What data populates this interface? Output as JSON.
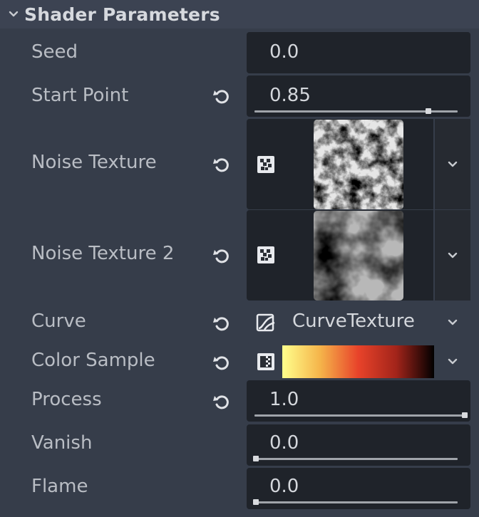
{
  "section": {
    "title": "Shader Parameters",
    "icon": "chevron-down-icon"
  },
  "params": {
    "seed": {
      "label": "Seed",
      "value": "0.0"
    },
    "start_point": {
      "label": "Start Point",
      "value": "0.85",
      "slider": 0.85
    },
    "noise_texture": {
      "label": "Noise Texture",
      "icon": "noise-texture-icon"
    },
    "noise_texture_2": {
      "label": "Noise Texture 2",
      "icon": "noise-texture-icon"
    },
    "curve": {
      "label": "Curve",
      "value": "CurveTexture",
      "icon": "curve-texture-icon"
    },
    "color_sample": {
      "label": "Color Sample",
      "icon": "gradient-texture-icon",
      "gradient": [
        "#ffff8c",
        "#f5b44a",
        "#e8432a",
        "#a3241a",
        "#000000"
      ]
    },
    "process": {
      "label": "Process",
      "value": "1.0",
      "slider": 1.0
    },
    "vanish": {
      "label": "Vanish",
      "value": "0.0",
      "slider": 0.0
    },
    "flame": {
      "label": "Flame",
      "value": "0.0",
      "slider": 0.0
    }
  },
  "colors": {
    "panel_bg": "#363d4a",
    "field_bg": "#1f232a",
    "label": "#b9bdc4",
    "value": "#d4d7dc"
  }
}
